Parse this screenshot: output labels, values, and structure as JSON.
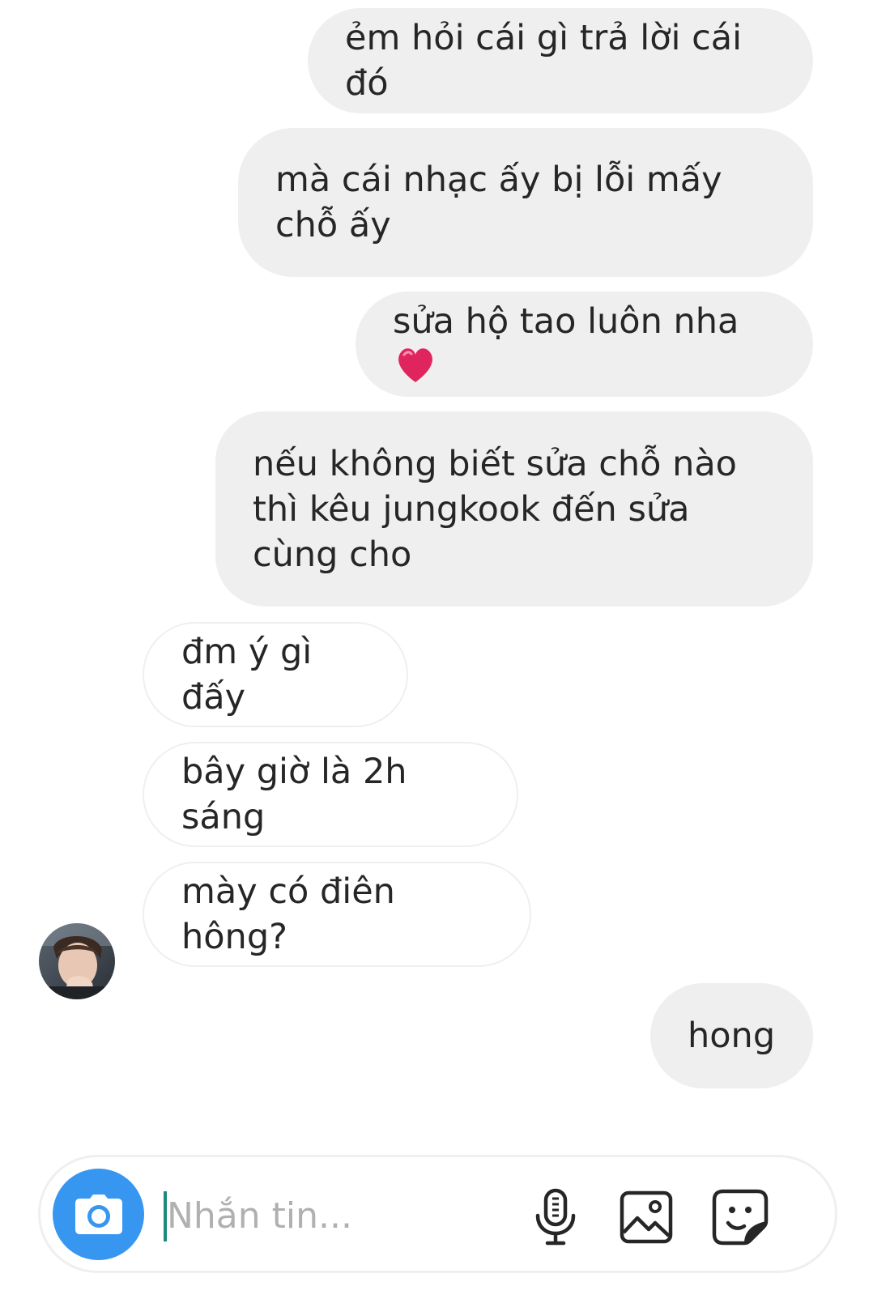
{
  "messages": [
    {
      "text": "ẻm hỏi cái gì trả lời cái đó",
      "from": "me"
    },
    {
      "text": "mà cái nhạc ấy bị lỗi mấy chỗ ấy",
      "from": "me"
    },
    {
      "text": "sửa hộ tao luôn nha",
      "from": "me",
      "emoji": "red-heart"
    },
    {
      "text": "nếu không biết sửa chỗ nào thì kêu jungkook đến sửa cùng cho",
      "from": "me"
    },
    {
      "text": "đm ý gì đấy",
      "from": "them"
    },
    {
      "text": "bây giờ là 2h sáng",
      "from": "them"
    },
    {
      "text": "mày có điên hông?",
      "from": "them"
    },
    {
      "text": "hong",
      "from": "me"
    }
  ],
  "composer": {
    "placeholder": "Nhắn tin...",
    "value": "",
    "icons": [
      "camera-icon",
      "microphone-icon",
      "gallery-icon",
      "sticker-icon"
    ]
  },
  "colors": {
    "sent_bubble": "#efefef",
    "received_border": "#efefef",
    "camera_button": "#3797f0",
    "text": "#262626",
    "placeholder": "#b0b0b0",
    "heart": "#e0245e"
  }
}
